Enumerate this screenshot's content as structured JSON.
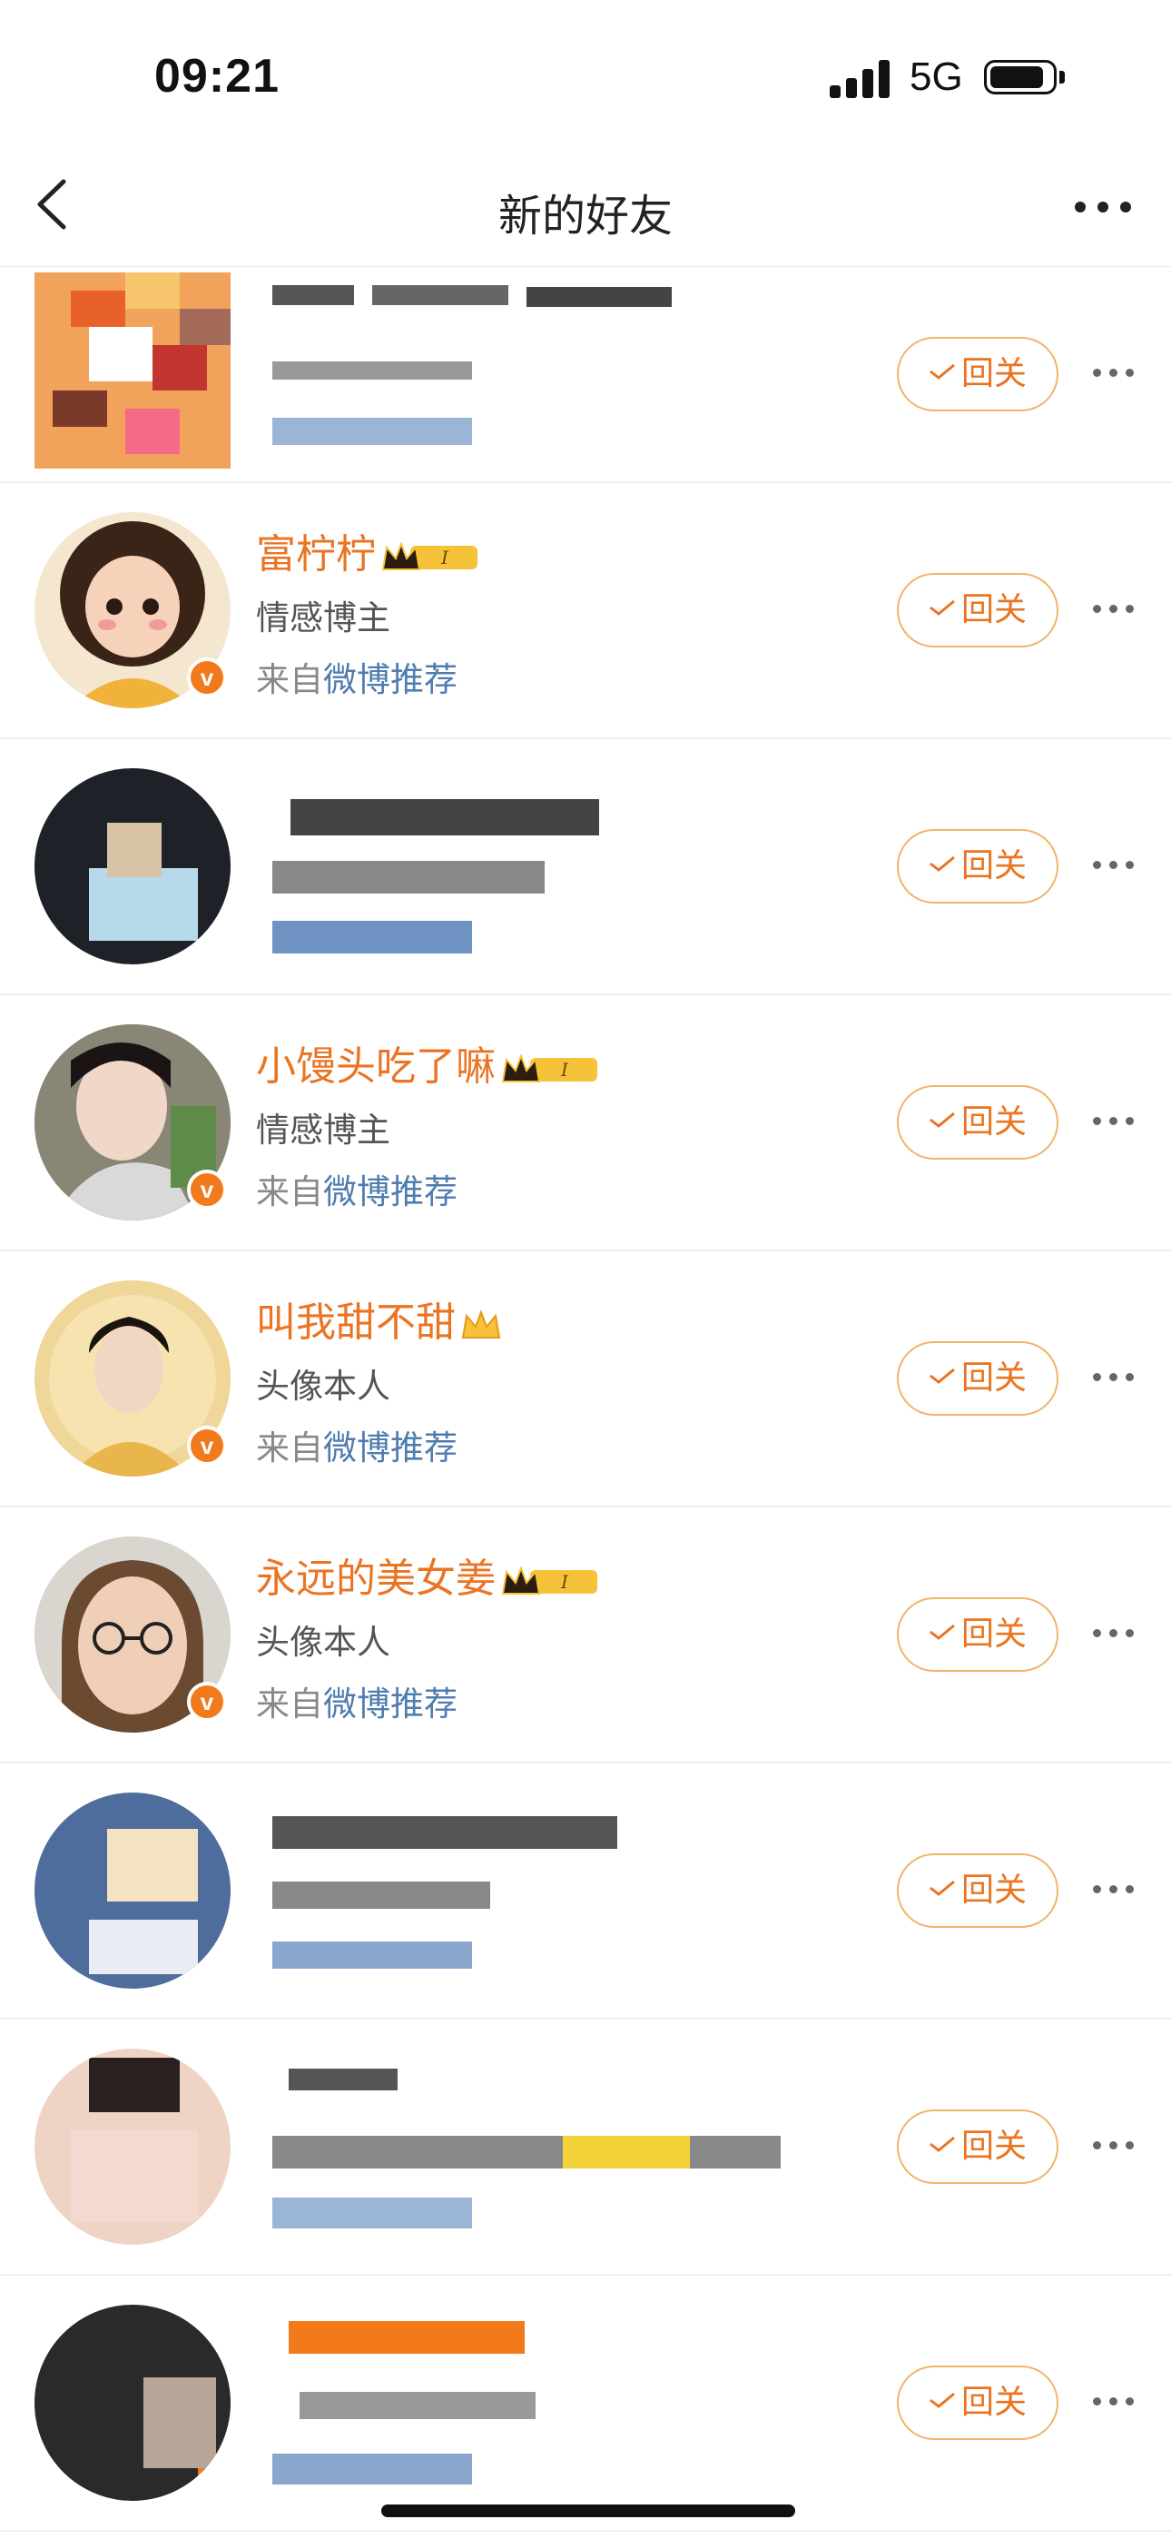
{
  "status_bar": {
    "time": "09:21",
    "network": "5G"
  },
  "nav": {
    "title": "新的好友",
    "back_icon": "chevron-left-icon",
    "more_icon": "ellipsis-icon"
  },
  "colors": {
    "accent": "#ea7422",
    "button_border": "#f0b46a",
    "link": "#507daf",
    "vbadge": "#f27a1a"
  },
  "follow_back_label": "回关",
  "from_prefix": "来自",
  "rows": [
    {
      "blurred": true
    },
    {
      "name": "富柠柠",
      "desc": "情感博主",
      "source": "微博推荐",
      "verified": true,
      "vip": true,
      "vip_level": "I"
    },
    {
      "blurred": true
    },
    {
      "name": "小馒头吃了嘛",
      "desc": "情感博主",
      "source": "微博推荐",
      "verified": true,
      "vip": true,
      "vip_level": "I"
    },
    {
      "name": "叫我甜不甜",
      "desc": "头像本人",
      "source": "微博推荐",
      "verified": true,
      "vip": true,
      "vip_level": ""
    },
    {
      "name": "永远的美女姜",
      "desc": "头像本人",
      "source": "微博推荐",
      "verified": true,
      "vip": true,
      "vip_level": "I"
    },
    {
      "blurred": true
    },
    {
      "blurred": true
    },
    {
      "blurred": true
    }
  ]
}
